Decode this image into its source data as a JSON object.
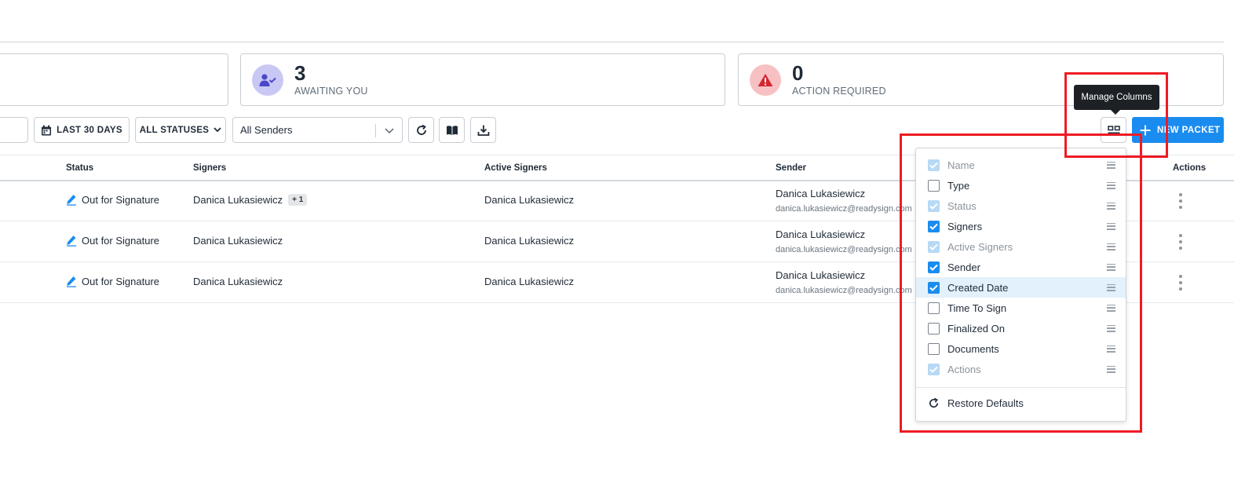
{
  "stats": [
    {
      "number": "",
      "label": ""
    },
    {
      "number": "3",
      "label": "AWAITING YOU"
    },
    {
      "number": "0",
      "label": "ACTION REQUIRED"
    }
  ],
  "toolbar": {
    "date_label": "LAST 30 DAYS",
    "status_label": "ALL STATUSES",
    "sender_value": "All Senders",
    "new_packet_label": "NEW PACKET",
    "tooltip": "Manage Columns"
  },
  "table": {
    "headers": {
      "status": "Status",
      "signers": "Signers",
      "active_signers": "Active Signers",
      "sender": "Sender",
      "actions": "Actions"
    },
    "rows": [
      {
        "status": "Out for Signature",
        "signers": "Danica Lukasiewicz",
        "badge": "+ 1",
        "active_signers": "Danica Lukasiewicz",
        "sender_name": "Danica Lukasiewicz",
        "sender_email": "danica.lukasiewicz@readysign.com"
      },
      {
        "status": "Out for Signature",
        "signers": "Danica Lukasiewicz",
        "active_signers": "Danica Lukasiewicz",
        "sender_name": "Danica Lukasiewicz",
        "sender_email": "danica.lukasiewicz@readysign.com"
      },
      {
        "status": "Out for Signature",
        "signers": "Danica Lukasiewicz",
        "active_signers": "Danica Lukasiewicz",
        "sender_name": "Danica Lukasiewicz",
        "sender_email": "danica.lukasiewicz@readysign.com"
      }
    ]
  },
  "columns_menu": {
    "items": [
      {
        "label": "Name",
        "checked": true,
        "disabled": true
      },
      {
        "label": "Type",
        "checked": false,
        "disabled": false
      },
      {
        "label": "Status",
        "checked": true,
        "disabled": true
      },
      {
        "label": "Signers",
        "checked": true,
        "disabled": false
      },
      {
        "label": "Active Signers",
        "checked": true,
        "disabled": true
      },
      {
        "label": "Sender",
        "checked": true,
        "disabled": false
      },
      {
        "label": "Created Date",
        "checked": true,
        "disabled": false,
        "highlighted": true
      },
      {
        "label": "Time To Sign",
        "checked": false,
        "disabled": false
      },
      {
        "label": "Finalized On",
        "checked": false,
        "disabled": false
      },
      {
        "label": "Documents",
        "checked": false,
        "disabled": false
      },
      {
        "label": "Actions",
        "checked": true,
        "disabled": true
      }
    ],
    "restore_label": "Restore Defaults"
  },
  "colors": {
    "accent": "#1a8cf0",
    "annotation": "#ee1b24",
    "awaiting_icon_bg": "#c9c8f4",
    "action_icon_bg": "#f7c1c3"
  }
}
